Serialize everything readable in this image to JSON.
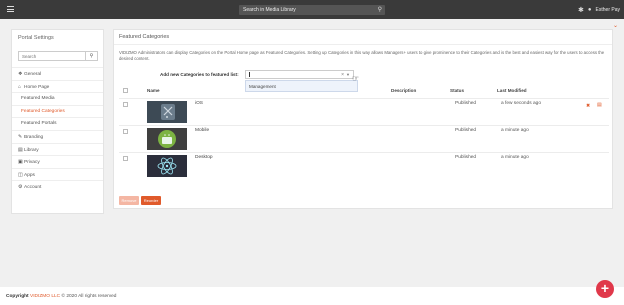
{
  "topbar": {
    "search_value": "Search in Media Library",
    "user_name": "Esther Pay"
  },
  "sidebar": {
    "title": "Portal Settings",
    "search_placeholder": "Search",
    "items": [
      {
        "label": "General",
        "icon": "info-icon"
      },
      {
        "label": "Home Page",
        "icon": "home-icon"
      },
      {
        "label": "Featured Media",
        "sub": true
      },
      {
        "label": "Featured Categories",
        "sub": true,
        "active": true
      },
      {
        "label": "Featured Portals",
        "sub": true
      },
      {
        "label": "Branding",
        "icon": "brush-icon"
      },
      {
        "label": "Library",
        "icon": "library-icon"
      },
      {
        "label": "Privacy",
        "icon": "lock-icon"
      },
      {
        "label": "Apps",
        "icon": "apps-icon"
      },
      {
        "label": "Account",
        "icon": "account-icon"
      }
    ]
  },
  "main": {
    "title": "Featured Categories",
    "description": "VIDIZMO Administrators can display Categories on the Portal Home page as Featured Categories. Setting up Categories in this way allows Managers+ users to give prominence to their Categories and is the best and easiest way for the users to access the desired content.",
    "add_label": "Add new Categories to featured list:",
    "dropdown_option": "Management",
    "columns": {
      "name": "Name",
      "description": "Description",
      "status": "Status",
      "last_modified": "Last Modified"
    },
    "rows": [
      {
        "name": "iOS",
        "status": "Published",
        "modified": "a few seconds ago",
        "thumb": "ios"
      },
      {
        "name": "Mobile",
        "status": "Published",
        "modified": "a minute ago",
        "thumb": "android"
      },
      {
        "name": "Desktop",
        "status": "Published",
        "modified": "a minute ago",
        "thumb": "electron"
      }
    ],
    "remove_label": "Remove",
    "reorder_label": "Reorder"
  },
  "footer": {
    "copyright_label": "Copyright",
    "brand": "VIDIZMO LLC",
    "rest": "© 2020 All rights reserved"
  },
  "colors": {
    "accent": "#e05a2b",
    "topbar": "#3a3a3a",
    "fab": "#e0384a"
  }
}
